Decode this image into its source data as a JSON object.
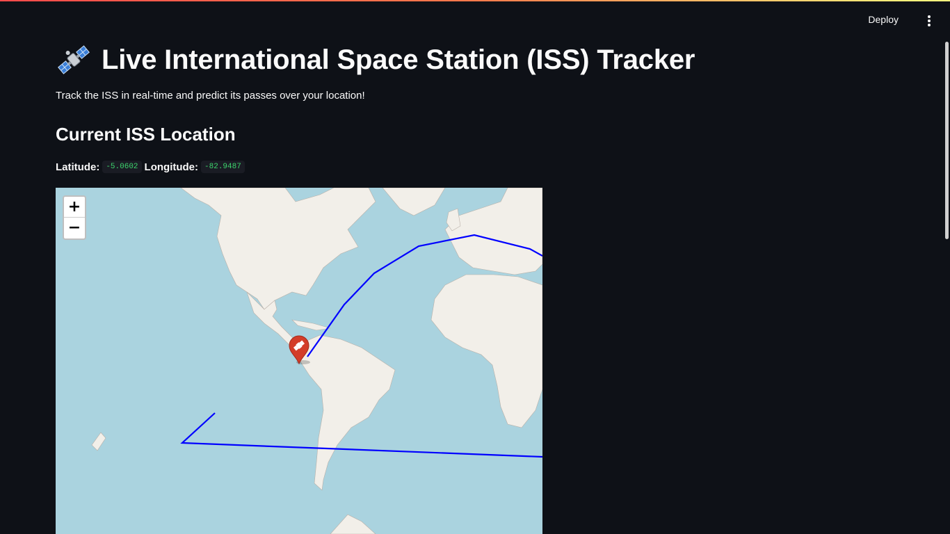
{
  "header": {
    "deploy_label": "Deploy",
    "menu_icon": "more-vertical-icon"
  },
  "page": {
    "title_icon": "satellite-emoji-icon",
    "title": "Live International Space Station (ISS) Tracker",
    "subtitle": "Track the ISS in real-time and predict its passes over your location!",
    "section_heading": "Current ISS Location",
    "latitude_label": "Latitude:",
    "latitude_value": "-5.0602",
    "longitude_label": "Longitude:",
    "longitude_value": "-82.9487"
  },
  "map": {
    "zoom_in_label": "+",
    "zoom_out_label": "−",
    "marker_icon": "satellite-marker-icon",
    "track_color": "#0000ff",
    "marker_color": "#d33d29",
    "ocean_color": "#aad3df",
    "land_color": "#f2efe9"
  },
  "colors": {
    "background": "#0e1117",
    "code_text": "#3dd56d"
  }
}
